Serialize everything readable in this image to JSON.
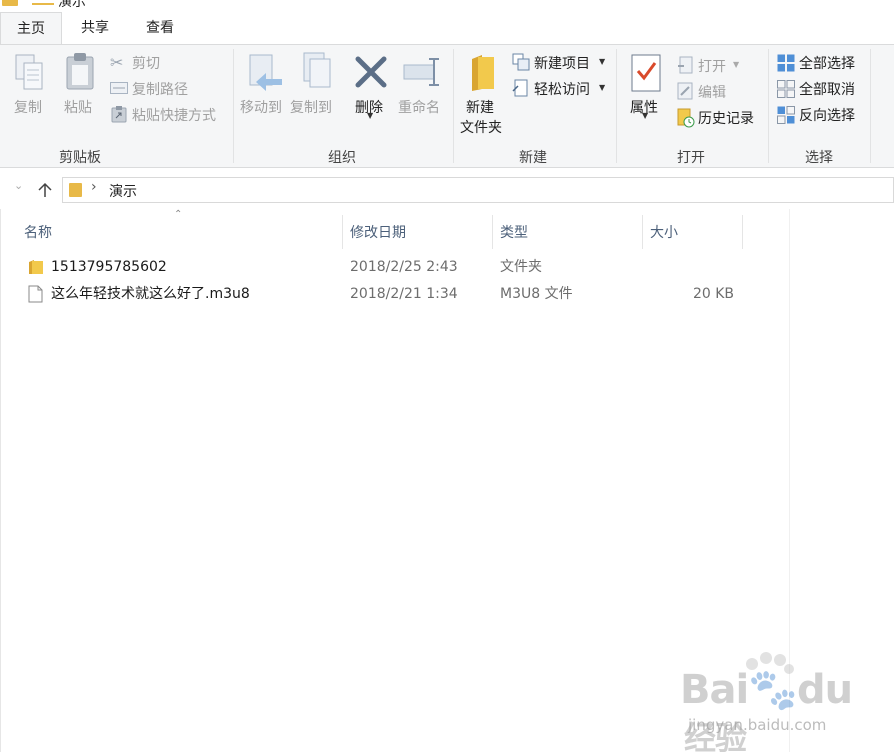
{
  "window": {
    "title": "演示"
  },
  "tabs": [
    {
      "label": "主页",
      "active": true
    },
    {
      "label": "共享",
      "active": false
    },
    {
      "label": "查看",
      "active": false
    }
  ],
  "ribbon": {
    "clipboard": {
      "label": "剪贴板",
      "copy": "复制",
      "paste": "粘贴",
      "cut": "剪切",
      "copy_path": "复制路径",
      "paste_shortcut": "粘贴快捷方式"
    },
    "organize": {
      "label": "组织",
      "move_to": "移动到",
      "copy_to": "复制到",
      "delete": "删除",
      "rename": "重命名"
    },
    "new": {
      "label": "新建",
      "new_folder_line1": "新建",
      "new_folder_line2": "文件夹",
      "new_item": "新建项目",
      "easy_access": "轻松访问"
    },
    "open": {
      "label": "打开",
      "properties": "属性",
      "open": "打开",
      "edit": "编辑",
      "history": "历史记录"
    },
    "select": {
      "label": "选择",
      "select_all": "全部选择",
      "select_none": "全部取消",
      "invert": "反向选择"
    }
  },
  "address": {
    "path": "演示"
  },
  "columns": {
    "name": "名称",
    "date": "修改日期",
    "type": "类型",
    "size": "大小"
  },
  "files": [
    {
      "name": "1513795785602",
      "date": "2018/2/25 2:43",
      "type": "文件夹",
      "size": "",
      "icon": "folder-icon"
    },
    {
      "name": "这么年轻技术就这么好了.m3u8",
      "date": "2018/2/21 1:34",
      "type": "M3U8 文件",
      "size": "20 KB",
      "icon": "file-icon"
    }
  ],
  "watermark": {
    "brand": "Bai",
    "brand_suffix": "du",
    "cn": "经验",
    "url": "jingyan.baidu.com"
  },
  "colors": {
    "accent": "#1979ca",
    "folder": "#e8b948",
    "ribbon_bg": "#f5f6f7",
    "header_text": "#4c607a"
  }
}
